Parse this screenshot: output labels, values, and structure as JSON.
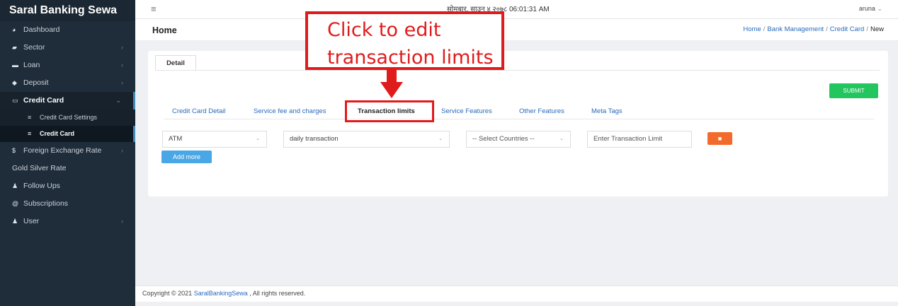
{
  "app": {
    "brand": "Saral Banking Sewa"
  },
  "sidebar": {
    "items": [
      {
        "label": "Dashboard",
        "icon": "dashboard-icon"
      },
      {
        "label": "Sector",
        "icon": "sector-icon"
      },
      {
        "label": "Loan",
        "icon": "loan-icon"
      },
      {
        "label": "Deposit",
        "icon": "deposit-icon"
      },
      {
        "label": "Credit Card",
        "icon": "credit-card-icon"
      },
      {
        "label": "Foreign Exchange Rate",
        "icon": "dollar-icon"
      },
      {
        "label": "Gold Silver Rate"
      },
      {
        "label": "Follow Ups",
        "icon": "follow-ups-icon"
      },
      {
        "label": "Subscriptions",
        "icon": "subscriptions-icon"
      },
      {
        "label": "User",
        "icon": "users-icon"
      }
    ],
    "subitems": [
      {
        "label": "Credit Card Settings"
      },
      {
        "label": "Credit Card"
      }
    ]
  },
  "topbar": {
    "datetime": "सोमबार, साउन ४ २०७८ 06:01:31 AM",
    "user": "aruna"
  },
  "page": {
    "title": "Home",
    "breadcrumb": [
      "Home",
      "Bank Management",
      "Credit Card",
      "New"
    ]
  },
  "card": {
    "tab": "Detail",
    "submit": "SUBMIT",
    "subtabs": [
      "Credit Card Detail",
      "Service fee and charges",
      "Transaction limits",
      "Service Features",
      "Other Features",
      "Meta Tags"
    ],
    "active_subtab": "Transaction limits",
    "row": {
      "channel": "ATM",
      "period": "daily transaction",
      "countries_placeholder": "-- Select Countries --",
      "limit_placeholder": "Enter Transaction Limit"
    },
    "add_more": "Add more"
  },
  "footer": {
    "prefix": "Copyright © 2021 ",
    "link": "SaralBankingSewa",
    "suffix": " , All rights reserved."
  },
  "annotation": {
    "line1": "Click to edit",
    "line2": "transaction limits",
    "color": "#e01b1b"
  },
  "colors": {
    "sidebar": "#1f2d3a",
    "submit": "#22c55e",
    "delete": "#f26b2c",
    "add_more": "#4aa7e6",
    "link": "#2a6bbd"
  }
}
